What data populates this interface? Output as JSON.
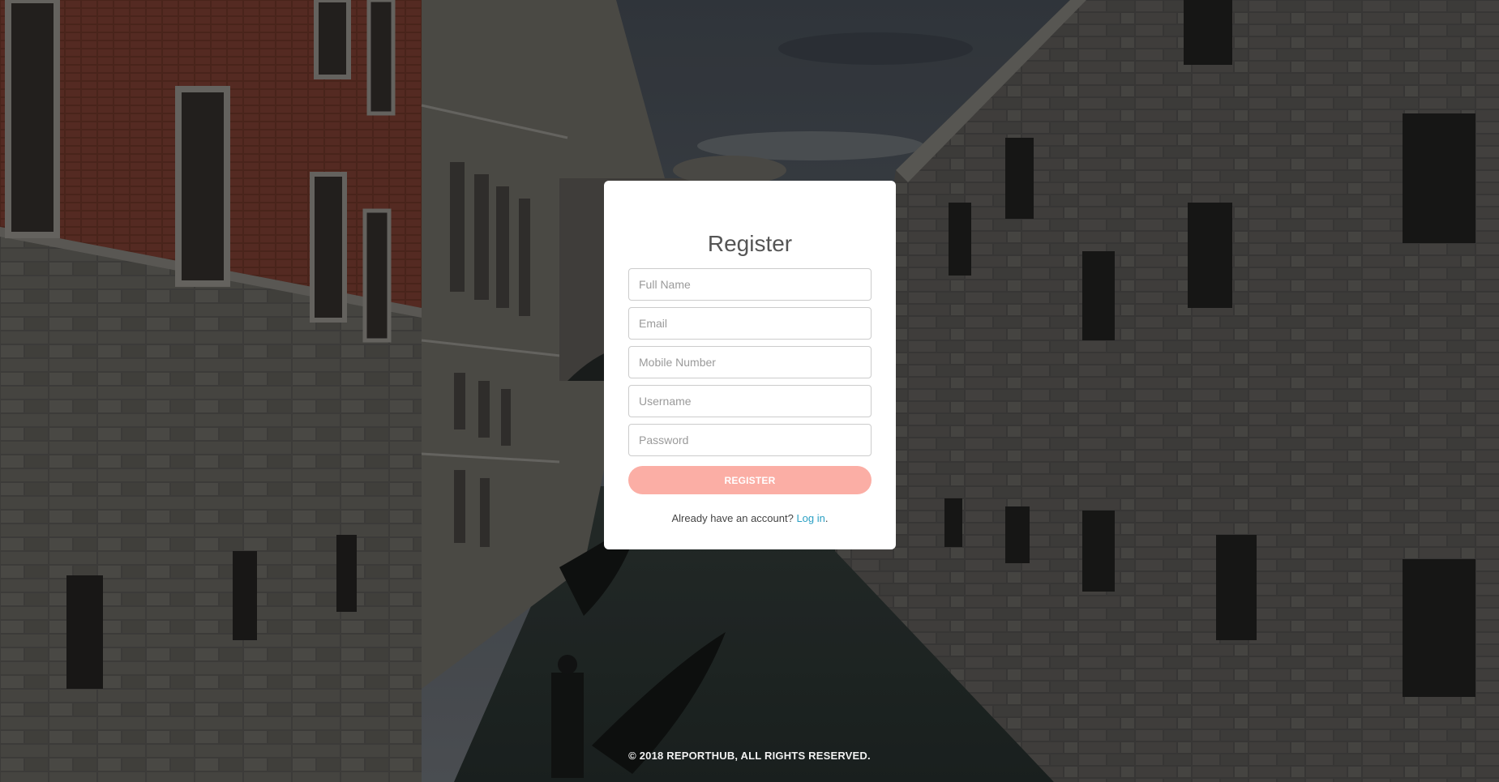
{
  "register": {
    "title": "Register",
    "full_name_placeholder": "Full Name",
    "email_placeholder": "Email",
    "mobile_placeholder": "Mobile Number",
    "username_placeholder": "Username",
    "password_placeholder": "Password",
    "button_label": "REGISTER",
    "account_prompt": "Already have an account?",
    "login_link": "Log in",
    "login_suffix": "."
  },
  "footer": {
    "copyright": "© 2018 REPORTHUB, ALL RIGHTS RESERVED."
  },
  "colors": {
    "button": "#fbaea5",
    "link": "#2ba0c4",
    "card": "#ffffff"
  }
}
